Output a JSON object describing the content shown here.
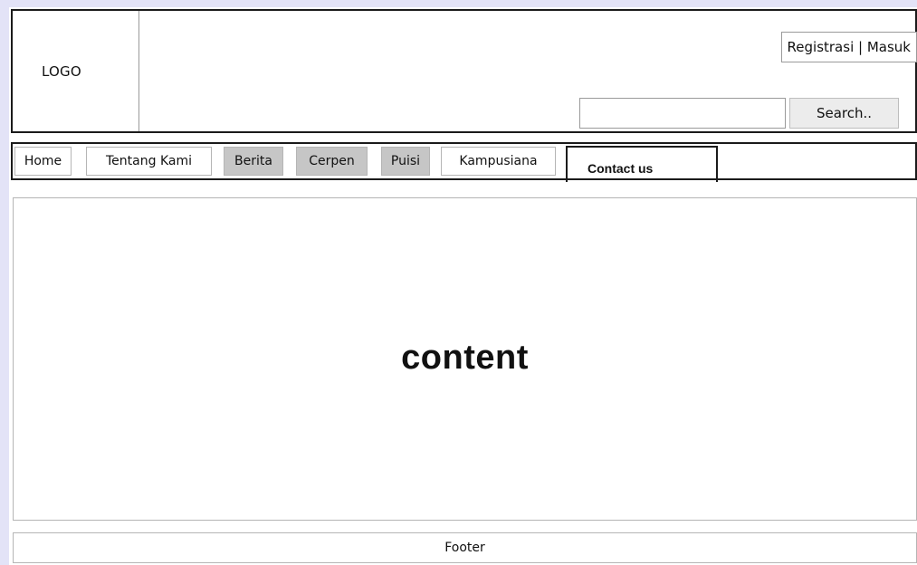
{
  "header": {
    "logo_text": "LOGO",
    "auth": {
      "register_label": "Registrasi",
      "separator": " | ",
      "login_label": "Masuk"
    },
    "search": {
      "value": "",
      "placeholder": "",
      "button_label": "Search.."
    }
  },
  "nav": {
    "items": [
      {
        "label": "Home",
        "highlighted": false
      },
      {
        "label": "Tentang Kami",
        "highlighted": false
      },
      {
        "label": "Berita",
        "highlighted": true
      },
      {
        "label": "Cerpen",
        "highlighted": true
      },
      {
        "label": "Puisi",
        "highlighted": true
      },
      {
        "label": "Kampusiana",
        "highlighted": false
      }
    ],
    "contact_label": "Contact us",
    "highlight_color": "#c6c6c6"
  },
  "main": {
    "content_label": "content"
  },
  "footer": {
    "label": "Footer"
  }
}
